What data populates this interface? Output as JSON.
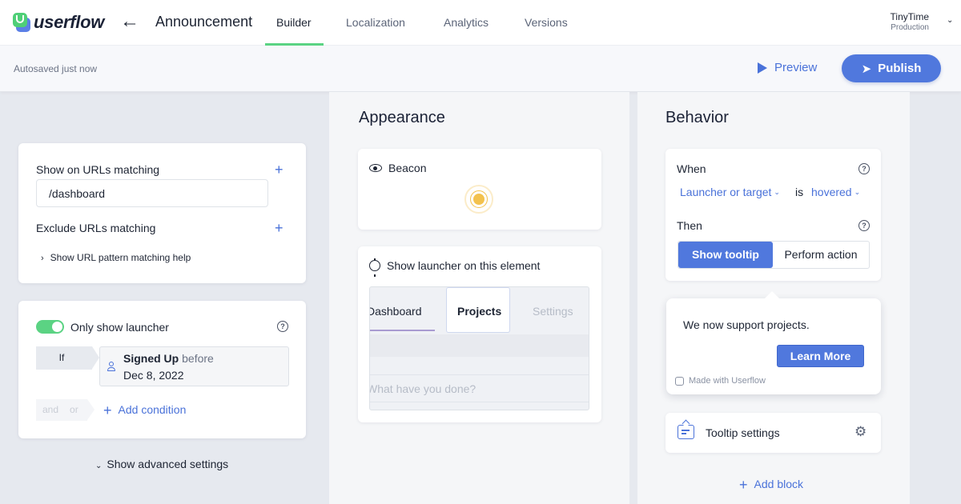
{
  "header": {
    "logo_text": "userflow",
    "back_icon": "arrow-left-icon",
    "title": "Announcement",
    "tabs": [
      {
        "label": "Builder",
        "active": true
      },
      {
        "label": "Localization",
        "active": false
      },
      {
        "label": "Analytics",
        "active": false
      },
      {
        "label": "Versions",
        "active": false
      }
    ],
    "workspace": {
      "name": "TinyTime",
      "environment": "Production"
    }
  },
  "toolbar": {
    "autosave_status": "Autosaved just now",
    "preview_label": "Preview",
    "publish_label": "Publish"
  },
  "conditions": {
    "show_on_label": "Show on URLs matching",
    "show_on_value": "/dashboard",
    "exclude_label": "Exclude URLs matching",
    "help_link": "Show URL pattern matching help",
    "only_launcher_label": "Only show launcher",
    "only_launcher_enabled": true,
    "if_label": "If",
    "condition": {
      "attribute": "Signed Up",
      "operator": "before",
      "value": "Dec 8, 2022"
    },
    "and_label": "and",
    "or_label": "or",
    "add_condition_label": "Add condition",
    "advanced_label": "Show advanced settings"
  },
  "appearance": {
    "title": "Appearance",
    "type_label": "Beacon",
    "beacon_color": "#f3c24e",
    "element_label": "Show launcher on this element",
    "preview_tabs": [
      "Dashboard",
      "Projects",
      "Settings"
    ],
    "preview_placeholder": "What have you done?"
  },
  "behavior": {
    "title": "Behavior",
    "when_label": "When",
    "trigger_target": "Launcher or target",
    "is_label": "is",
    "trigger_event": "hovered",
    "then_label": "Then",
    "actions": [
      {
        "label": "Show tooltip",
        "selected": true
      },
      {
        "label": "Perform action",
        "selected": false
      }
    ],
    "tooltip": {
      "text": "We now support projects.",
      "button_label": "Learn More",
      "branding": "Made with Userflow"
    },
    "tooltip_settings_label": "Tooltip settings",
    "add_block_label": "Add block"
  },
  "colors": {
    "accent": "#5078dd",
    "link": "#4a72d9",
    "toggle_on": "#5bd383"
  }
}
